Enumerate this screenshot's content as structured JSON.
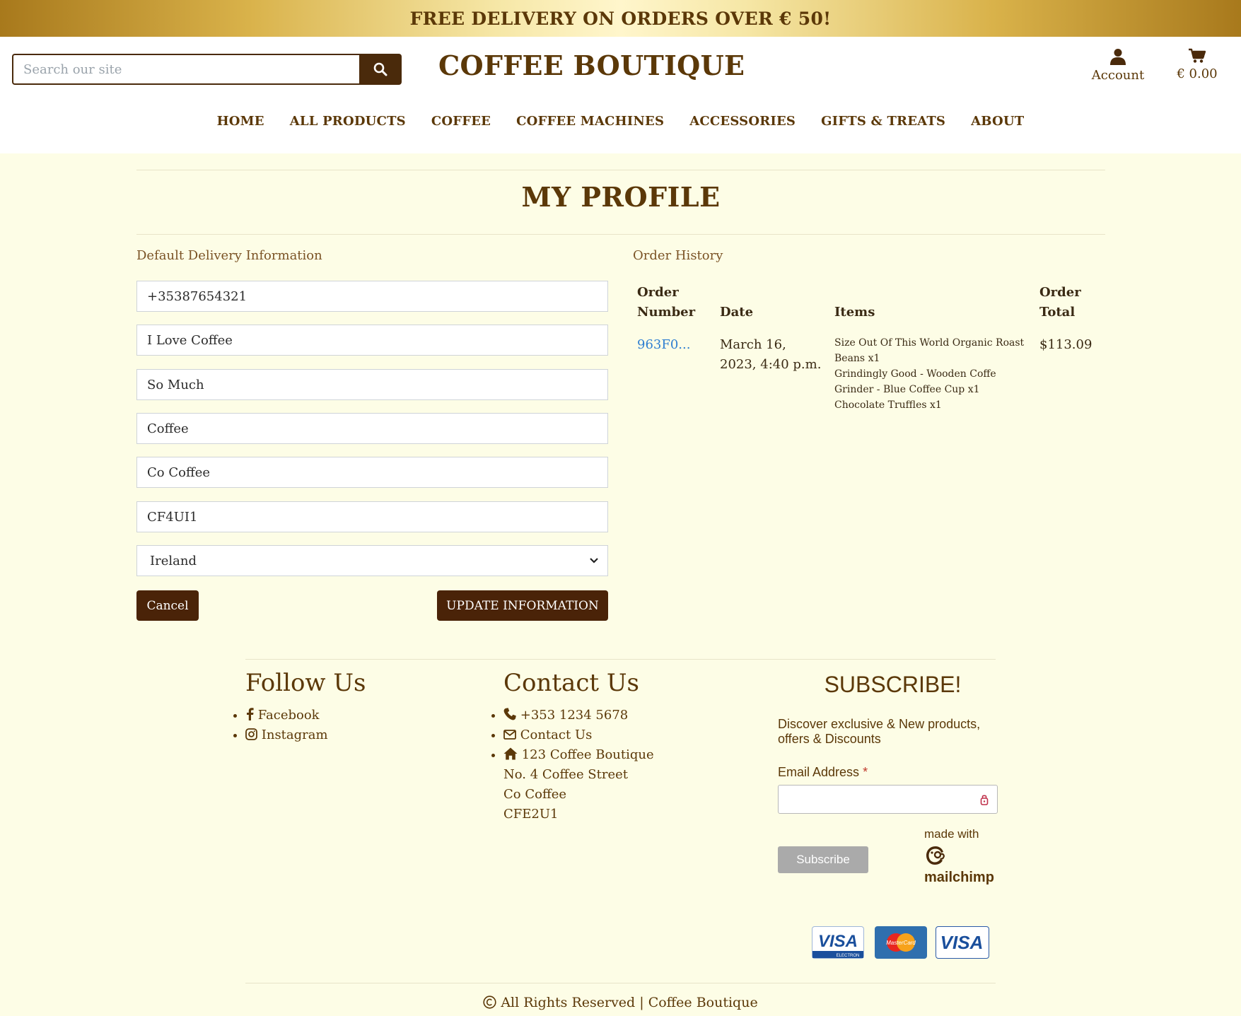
{
  "banner": {
    "text": "FREE DELIVERY ON ORDERS OVER € 50!"
  },
  "header": {
    "search_placeholder": "Search our site",
    "brand": "COFFEE BOUTIQUE",
    "account_label": "Account",
    "cart_total": "€ 0.00"
  },
  "nav": {
    "items": [
      "HOME",
      "ALL PRODUCTS",
      "COFFEE",
      "COFFEE MACHINES",
      "ACCESSORIES",
      "GIFTS & TREATS",
      "ABOUT"
    ]
  },
  "page": {
    "title": "MY PROFILE"
  },
  "delivery": {
    "heading": "Default Delivery Information",
    "phone": "+35387654321",
    "street1": "I Love Coffee",
    "street2": "So Much",
    "town": "Coffee",
    "county": "Co Coffee",
    "postcode": "CF4UI1",
    "country": "Ireland",
    "cancel_label": "Cancel",
    "update_label": "UPDATE INFORMATION"
  },
  "orders": {
    "heading": "Order History",
    "columns": {
      "number_line1": "Order",
      "number_line2": "Number",
      "date": "Date",
      "items": "Items",
      "total_line1": "Order",
      "total_line2": "Total"
    },
    "rows": [
      {
        "number": "963F0...",
        "date": "March 16, 2023, 4:40 p.m.",
        "items": [
          "Size Out Of This World Organic Roast Beans x1",
          "Grindingly Good - Wooden Coffe Grinder - Blue Coffee Cup x1",
          "Chocolate Truffles x1"
        ],
        "total": "$113.09"
      }
    ]
  },
  "footer": {
    "follow": {
      "title": "Follow Us",
      "facebook": "Facebook",
      "instagram": "Instagram"
    },
    "contact": {
      "title": "Contact Us",
      "phone": "+353 1234 5678",
      "contact_link": "Contact Us",
      "address_line1": "123 Coffee Boutique",
      "address_line2": "No. 4 Coffee Street",
      "address_line3": "Co Coffee",
      "address_line4": "CFE2U1"
    },
    "subscribe": {
      "title": "SUBSCRIBE!",
      "text": "Discover exclusive & New products, offers & Discounts",
      "email_label": "Email Address",
      "required_mark": "*",
      "button": "Subscribe",
      "made_with": "made with",
      "mailchimp": "mailchimp"
    },
    "cards": {
      "visa_electron": "VISA",
      "visa_electron_sub": "ELECTRON",
      "mastercard": "MasterCard",
      "visa": "VISA"
    },
    "copyright": "All Rights Reserved | Coffee Boutique"
  },
  "colors": {
    "brand_brown": "#5b3808",
    "dark_button": "#4a2308",
    "page_bg": "#fdfde6",
    "link_blue": "#2f7fd1"
  }
}
